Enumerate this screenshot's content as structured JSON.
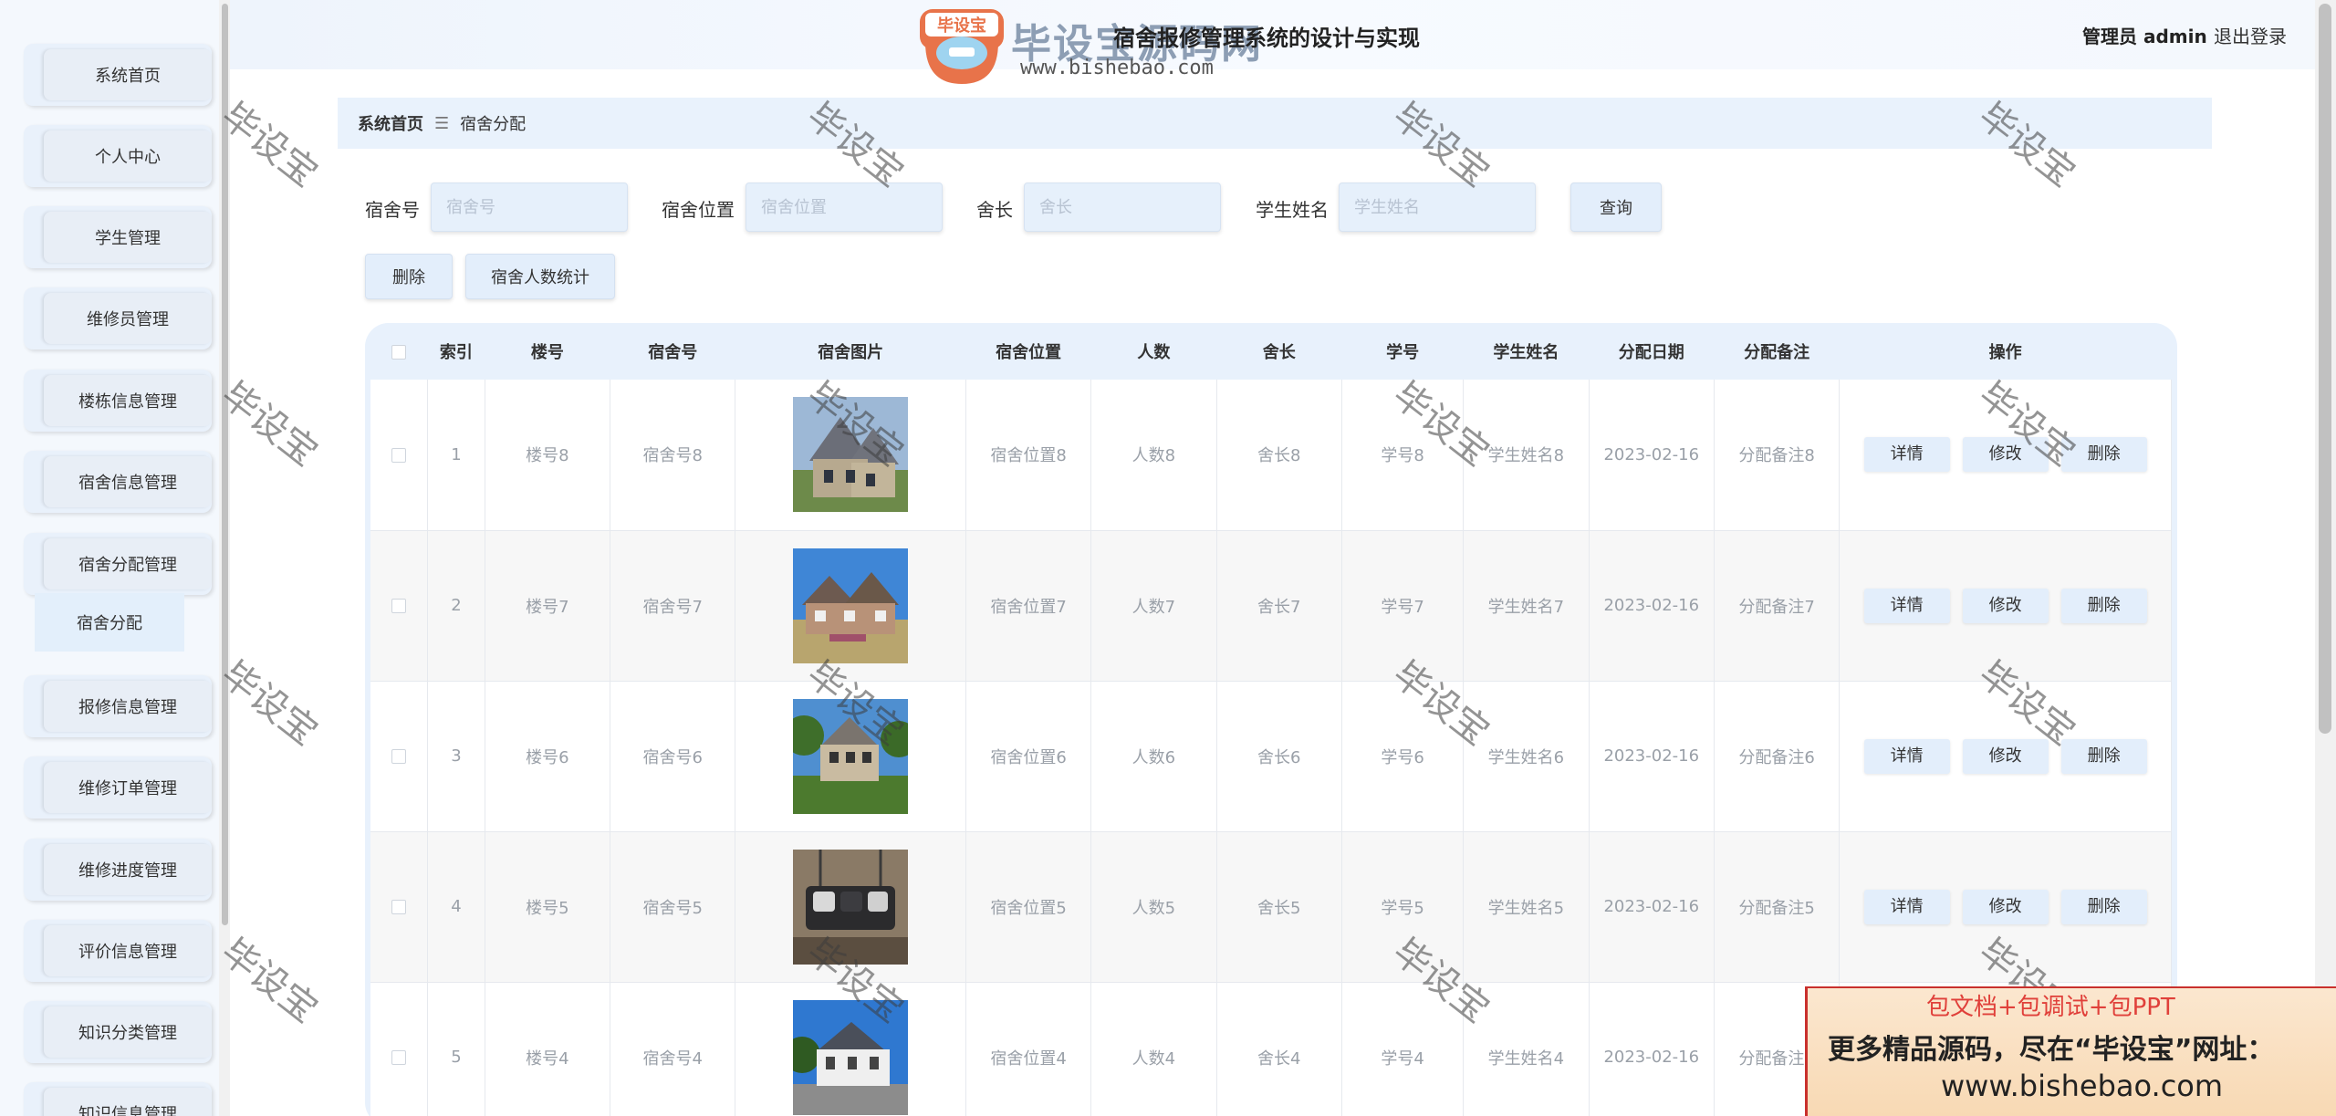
{
  "header": {
    "logo_text": "毕设宝源码网",
    "logo_badge": "毕设宝",
    "logo_url": "www.bishebao.com",
    "system_title": "宿舍报修管理系统的设计与实现",
    "admin_label": "管理员 admin",
    "logout_label": "退出登录"
  },
  "sidebar": {
    "items": [
      {
        "label": "系统首页"
      },
      {
        "label": "个人中心"
      },
      {
        "label": "学生管理"
      },
      {
        "label": "维修员管理"
      },
      {
        "label": "楼栋信息管理"
      },
      {
        "label": "宿舍信息管理"
      },
      {
        "label": "宿舍分配管理"
      },
      {
        "label": "报修信息管理"
      },
      {
        "label": "维修订单管理"
      },
      {
        "label": "维修进度管理"
      },
      {
        "label": "评价信息管理"
      },
      {
        "label": "知识分类管理"
      },
      {
        "label": "知识信息管理"
      }
    ],
    "sub_item": "宿舍分配"
  },
  "breadcrumb": {
    "home": "系统首页",
    "separator": "☰",
    "current": "宿舍分配"
  },
  "search": {
    "dorm_no_label": "宿舍号",
    "dorm_no_placeholder": "宿舍号",
    "location_label": "宿舍位置",
    "location_placeholder": "宿舍位置",
    "leader_label": "舍长",
    "leader_placeholder": "舍长",
    "student_label": "学生姓名",
    "student_placeholder": "学生姓名",
    "query_button": "查询"
  },
  "actions": {
    "delete_button": "删除",
    "stats_button": "宿舍人数统计"
  },
  "table": {
    "headers": [
      "索引",
      "楼号",
      "宿舍号",
      "宿舍图片",
      "宿舍位置",
      "人数",
      "舍长",
      "学号",
      "学生姓名",
      "分配日期",
      "分配备注",
      "操作"
    ],
    "op_labels": {
      "detail": "详情",
      "edit": "修改",
      "delete": "删除"
    },
    "rows": [
      {
        "index": "1",
        "building": "楼号8",
        "dorm": "宿舍号8",
        "location": "宿舍位置8",
        "count": "人数8",
        "leader": "舍长8",
        "student_no": "学号8",
        "student_name": "学生姓名8",
        "date": "2023-02-16",
        "remark": "分配备注8"
      },
      {
        "index": "2",
        "building": "楼号7",
        "dorm": "宿舍号7",
        "location": "宿舍位置7",
        "count": "人数7",
        "leader": "舍长7",
        "student_no": "学号7",
        "student_name": "学生姓名7",
        "date": "2023-02-16",
        "remark": "分配备注7"
      },
      {
        "index": "3",
        "building": "楼号6",
        "dorm": "宿舍号6",
        "location": "宿舍位置6",
        "count": "人数6",
        "leader": "舍长6",
        "student_no": "学号6",
        "student_name": "学生姓名6",
        "date": "2023-02-16",
        "remark": "分配备注6"
      },
      {
        "index": "4",
        "building": "楼号5",
        "dorm": "宿舍号5",
        "location": "宿舍位置5",
        "count": "人数5",
        "leader": "舍长5",
        "student_no": "学号5",
        "student_name": "学生姓名5",
        "date": "2023-02-16",
        "remark": "分配备注5"
      },
      {
        "index": "5",
        "building": "楼号4",
        "dorm": "宿舍号4",
        "location": "宿舍位置4",
        "count": "人数4",
        "leader": "舍长4",
        "student_no": "学号4",
        "student_name": "学生姓名4",
        "date": "2023-02-16",
        "remark": "分配备注4"
      }
    ]
  },
  "watermark": "毕设宝",
  "ad": {
    "line1": "包文档+包调试+包PPT",
    "line2": "更多精品源码，尽在“毕设宝”网址：",
    "line3": "www.bishebao.com"
  }
}
